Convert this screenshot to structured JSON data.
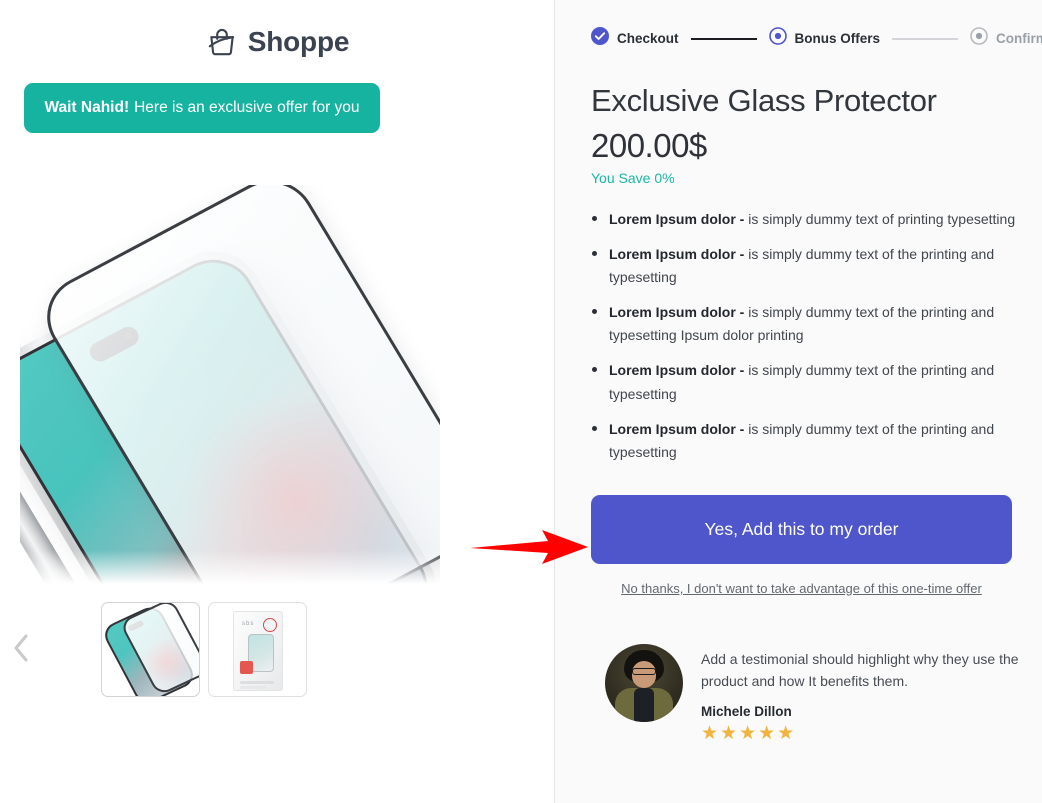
{
  "brand": {
    "name": "Shoppe",
    "logo_icon": "shopping-bag-icon"
  },
  "promo": {
    "highlight": "Wait Nahid!",
    "message": "Here is an exclusive offer for you",
    "background_color": "#16b3a0"
  },
  "gallery": {
    "prev_icon": "chevron-left-icon",
    "main_image_alt": "iPhone with tempered glass screen protector",
    "thumbnails": [
      {
        "name": "thumbnail-product-phone",
        "alt": "Phone with glass protector",
        "selected": true
      },
      {
        "name": "thumbnail-product-package",
        "alt": "Retail package box",
        "selected": false
      }
    ]
  },
  "stepper": {
    "steps": [
      {
        "label": "Checkout",
        "state": "completed",
        "icon": "check-circle-icon"
      },
      {
        "label": "Bonus Offers",
        "state": "active",
        "icon": "radio-filled-icon"
      },
      {
        "label": "Confirmation",
        "state": "upcoming",
        "icon": "radio-filled-icon"
      }
    ],
    "active_color": "#4f55ca",
    "muted_color": "#9aa0a8"
  },
  "offer": {
    "title": "Exclusive Glass Protector",
    "price": "200.00$",
    "savings": "You Save 0%",
    "savings_color": "#18b8a6",
    "features": [
      {
        "strong": "Lorem Ipsum dolor -",
        "text": " is simply dummy text of printing typesetting"
      },
      {
        "strong": "Lorem Ipsum dolor -",
        "text": " is simply dummy text of the printing and typesetting"
      },
      {
        "strong": "Lorem Ipsum dolor -",
        "text": " is simply dummy text of the printing and typesetting Ipsum dolor printing"
      },
      {
        "strong": "Lorem Ipsum dolor -",
        "text": " is simply dummy text of the printing and typesetting"
      },
      {
        "strong": "Lorem Ipsum dolor -",
        "text": " is simply dummy text of the printing and typesetting"
      }
    ],
    "accept_label": "Yes, Add this to my order",
    "accept_color": "#4f55ca",
    "decline_label": "No thanks, I don't want to take advantage of this one-time offer"
  },
  "testimonial": {
    "quote": "Add a testimonial should highlight why they use the product and how It benefits them.",
    "author": "Michele Dillon",
    "avatar_alt": "Portrait of Michele Dillon",
    "rating": 5,
    "stars": "★★★★★",
    "star_color": "#f0b43f"
  },
  "annotation": {
    "arrow_icon": "red-arrow-right-icon",
    "color": "#ff0000",
    "points_to": "Yes, Add this to my order"
  }
}
